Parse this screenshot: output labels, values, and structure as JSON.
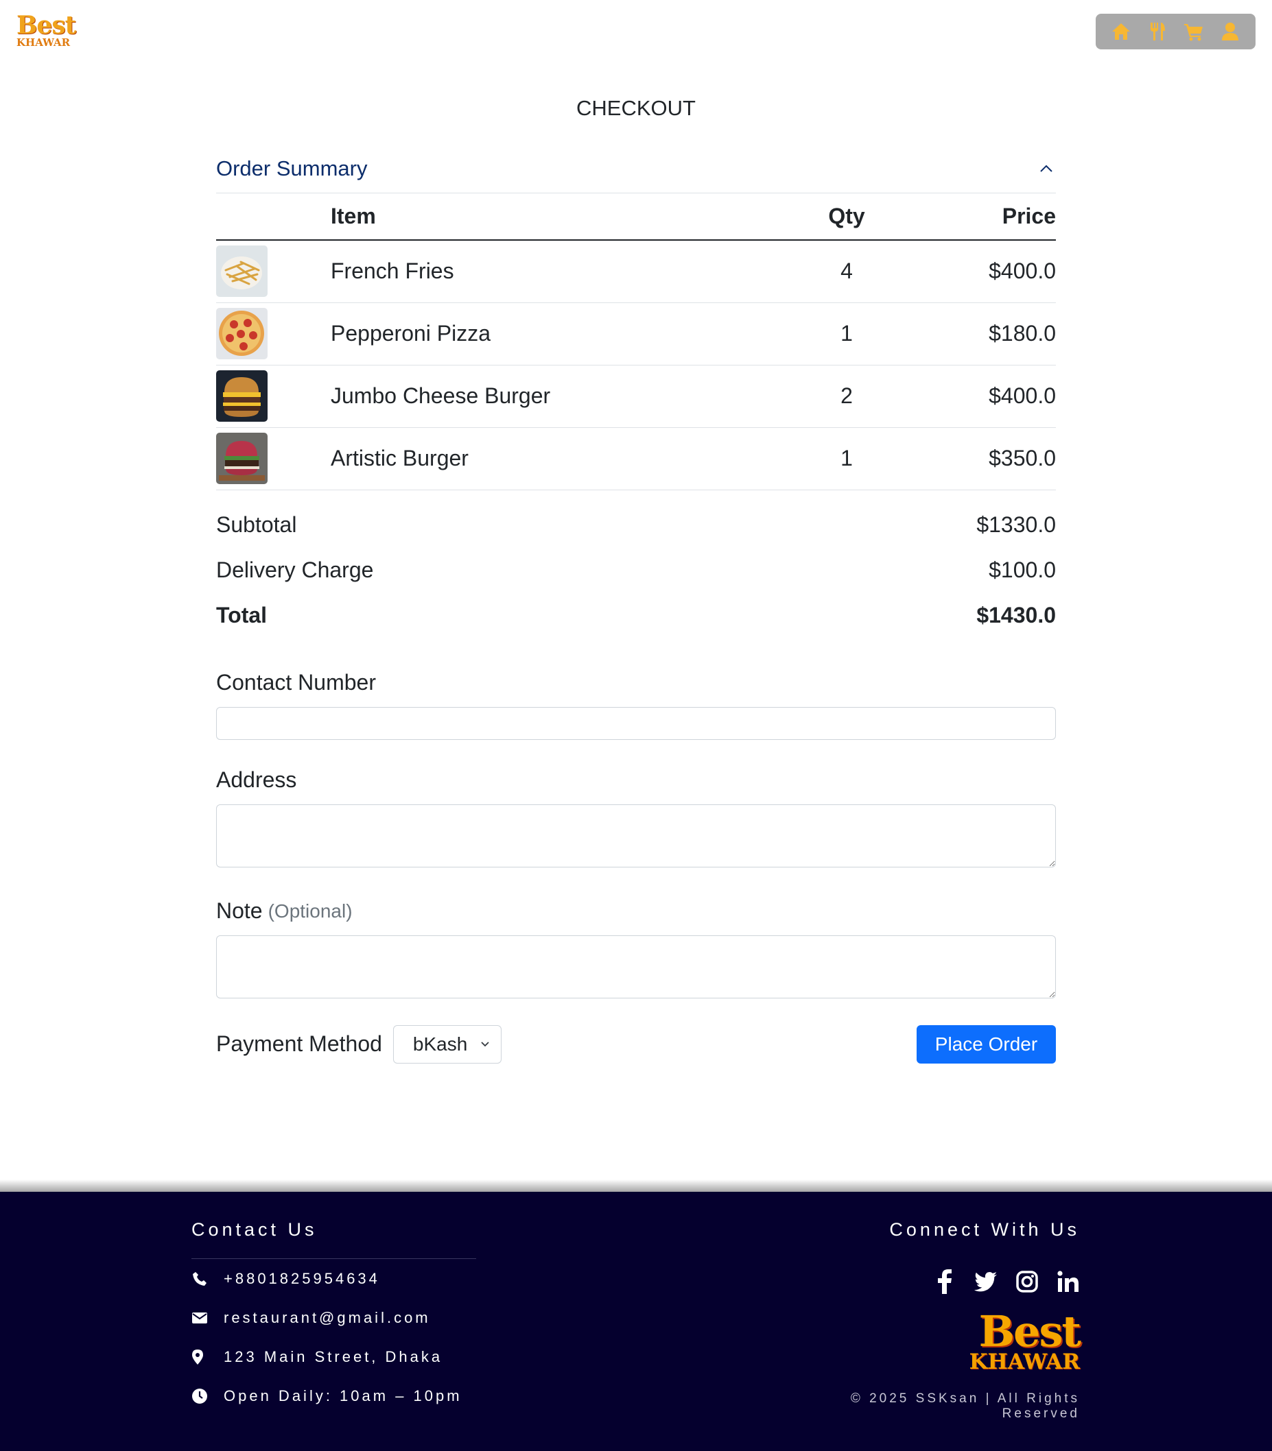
{
  "brand": {
    "line1": "Best",
    "line2": "KHAWAR"
  },
  "nav": {
    "icons": [
      "home-icon",
      "utensils-icon",
      "cart-icon",
      "user-icon"
    ],
    "icon_color": "#f7b733",
    "bg_color": "#a9a9a9"
  },
  "page": {
    "title": "CHECKOUT"
  },
  "summary": {
    "title": "Order Summary",
    "columns": {
      "item": "Item",
      "qty": "Qty",
      "price": "Price"
    },
    "items": [
      {
        "name": "French Fries",
        "qty": "4",
        "price": "$400.0",
        "image": "french-fries-image"
      },
      {
        "name": "Pepperoni Pizza",
        "qty": "1",
        "price": "$180.0",
        "image": "pepperoni-pizza-image"
      },
      {
        "name": "Jumbo Cheese Burger",
        "qty": "2",
        "price": "$400.0",
        "image": "jumbo-cheese-burger-image"
      },
      {
        "name": "Artistic Burger",
        "qty": "1",
        "price": "$350.0",
        "image": "artistic-burger-image"
      }
    ],
    "subtotal_label": "Subtotal",
    "subtotal_value": "$1330.0",
    "delivery_label": "Delivery Charge",
    "delivery_value": "$100.0",
    "total_label": "Total",
    "total_value": "$1430.0"
  },
  "form": {
    "contact_label": "Contact Number",
    "contact_value": "",
    "address_label": "Address",
    "address_value": "",
    "note_label": "Note",
    "note_optional": "(Optional)",
    "note_value": "",
    "payment_label": "Payment Method",
    "payment_selected": "bKash",
    "place_order": "Place Order"
  },
  "footer": {
    "contact_heading": "Contact Us",
    "phone": "+8801825954634",
    "email": "restaurant@gmail.com",
    "address": "123 Main Street, Dhaka",
    "hours": "Open Daily: 10am – 10pm",
    "connect_heading": "Connect With Us",
    "socials": [
      "facebook-icon",
      "twitter-icon",
      "instagram-icon",
      "linkedin-icon"
    ],
    "brand_line1": "Best",
    "brand_line2": "KHAWAR",
    "copyright": "© 2025 SSKsan | All Rights Reserved",
    "bg_color": "#05002e"
  },
  "colors": {
    "accent": "#0d6efd",
    "summary_title": "#0c2d6b"
  }
}
